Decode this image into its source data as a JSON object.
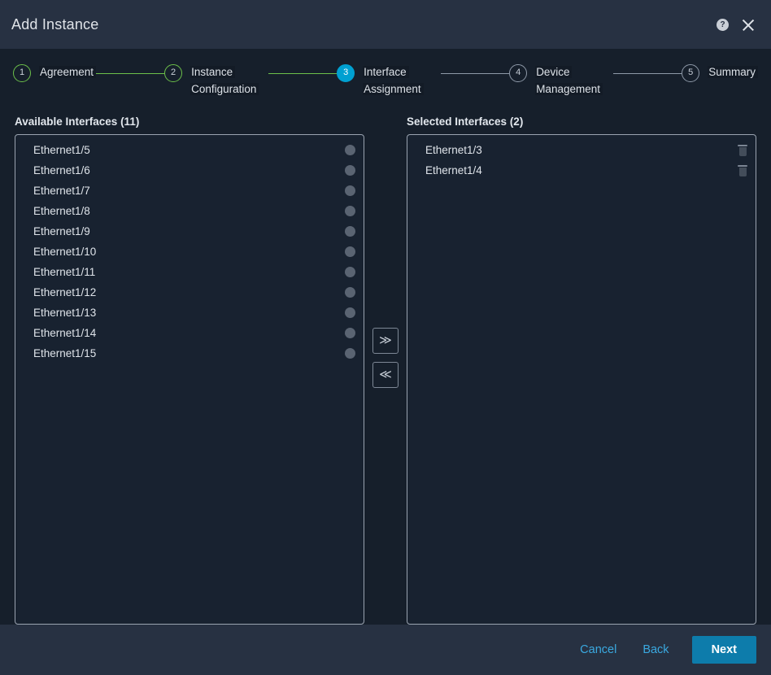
{
  "titlebar": {
    "title": "Add Instance",
    "help_icon": "help-circle-icon",
    "help_glyph": "?",
    "close_icon": "close-icon"
  },
  "stepper": {
    "steps": [
      {
        "number": "1",
        "label": "Agreement",
        "state": "done"
      },
      {
        "number": "2",
        "label": "Instance Configuration",
        "state": "done"
      },
      {
        "number": "3",
        "label": "Interface Assignment",
        "state": "active"
      },
      {
        "number": "4",
        "label": "Device Management",
        "state": "inactive"
      },
      {
        "number": "5",
        "label": "Summary",
        "state": "inactive"
      }
    ],
    "colors": {
      "done": "#6cc04a",
      "active": "#00a0d1",
      "inactive": "#8e99a8"
    }
  },
  "available": {
    "title": "Available Interfaces (11)",
    "items": [
      "Ethernet1/5",
      "Ethernet1/6",
      "Ethernet1/7",
      "Ethernet1/8",
      "Ethernet1/9",
      "Ethernet1/10",
      "Ethernet1/11",
      "Ethernet1/12",
      "Ethernet1/13",
      "Ethernet1/14",
      "Ethernet1/15"
    ]
  },
  "selected": {
    "title": "Selected Interfaces (2)",
    "items": [
      "Ethernet1/3",
      "Ethernet1/4"
    ]
  },
  "transfer": {
    "add_label": "≫",
    "remove_label": "≪"
  },
  "footer": {
    "cancel_label": "Cancel",
    "back_label": "Back",
    "next_label": "Next",
    "primary_color": "#0d7cab",
    "link_color": "#3aa9e0"
  }
}
